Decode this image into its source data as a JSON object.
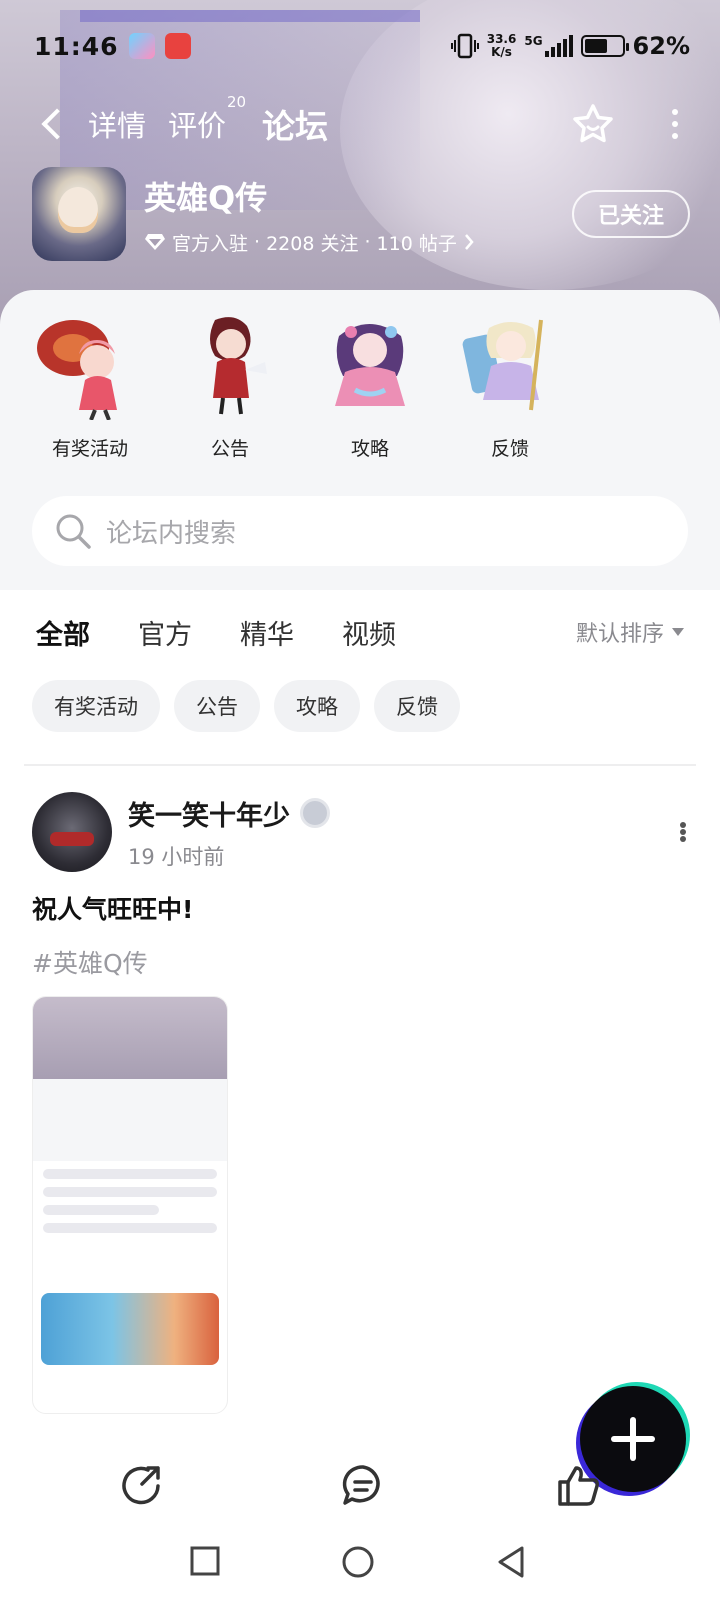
{
  "status_bar": {
    "time": "11:46",
    "net_speed_value": "33.6",
    "net_speed_unit": "K/s",
    "network": "5G",
    "battery": "62%",
    "battery_level": 0.62
  },
  "nav": {
    "tabs": [
      {
        "label": "详情"
      },
      {
        "label": "评价",
        "badge": "20"
      },
      {
        "label": "论坛"
      }
    ],
    "accent_color": "#1fd8b5"
  },
  "game": {
    "title": "英雄Q传",
    "official": "官方入驻",
    "follows": "2208 关注",
    "posts": "110 帖子",
    "sep": "·",
    "follow_button": "已关注"
  },
  "categories": [
    {
      "label": "有奖活动",
      "icon": "character-red-umbrella-icon"
    },
    {
      "label": "公告",
      "icon": "character-fan-icon"
    },
    {
      "label": "攻略",
      "icon": "character-flower-icon"
    },
    {
      "label": "反馈",
      "icon": "character-staff-icon"
    }
  ],
  "search": {
    "placeholder": "论坛内搜索"
  },
  "filters": {
    "tabs": [
      "全部",
      "官方",
      "精华",
      "视频"
    ],
    "sort": "默认排序"
  },
  "chips": [
    "有奖活动",
    "公告",
    "攻略",
    "反馈"
  ],
  "post": {
    "author": "笑一笑十年少",
    "time": "19 小时前",
    "content": "祝人气旺旺中!",
    "tag": "#英雄Q传"
  }
}
